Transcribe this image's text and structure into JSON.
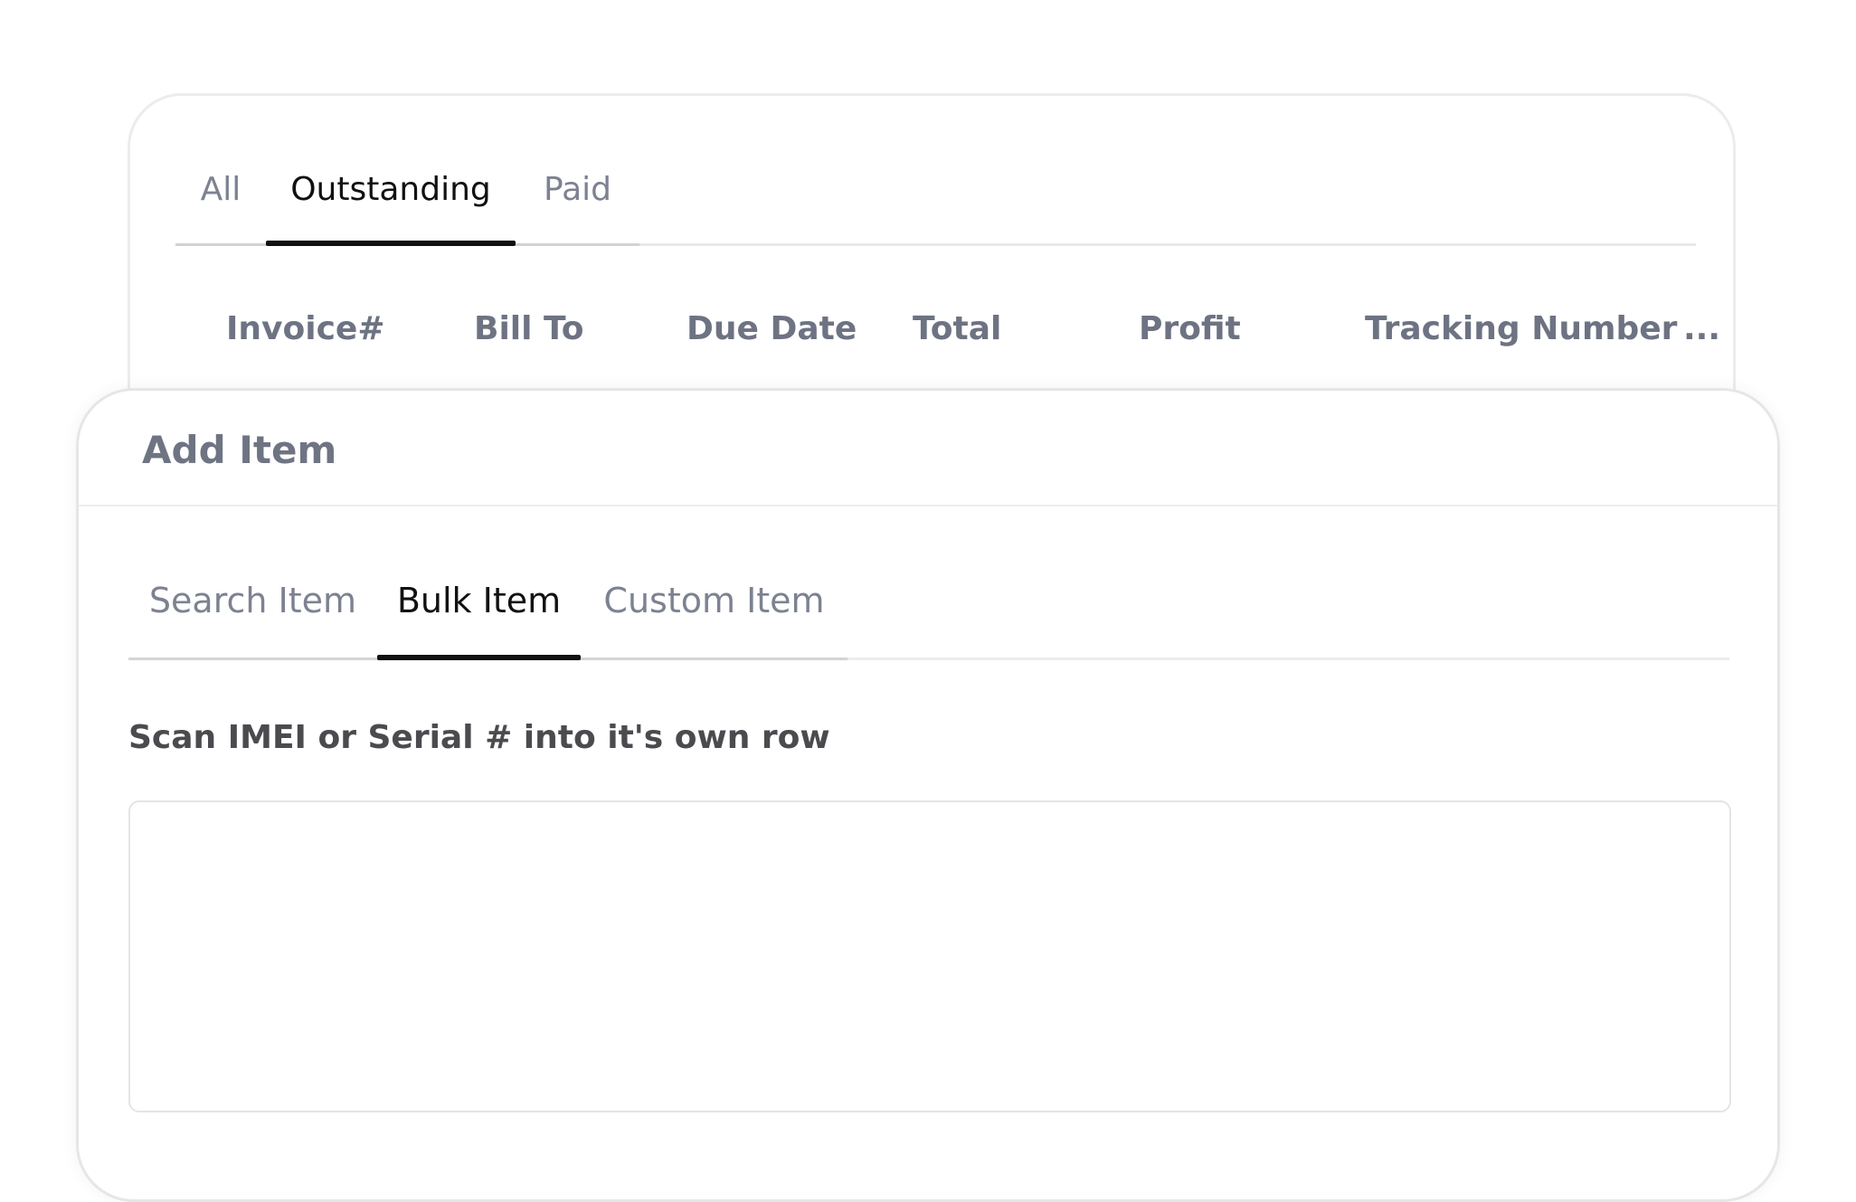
{
  "invoices": {
    "tabs": [
      {
        "label": "All",
        "active": false
      },
      {
        "label": "Outstanding",
        "active": true
      },
      {
        "label": "Paid",
        "active": false
      }
    ],
    "columns": [
      "Invoice#",
      "Bill To",
      "Due Date",
      "Total",
      "Profit",
      "Tracking Number"
    ],
    "more_columns_label": "..."
  },
  "add_item": {
    "title": "Add Item",
    "tabs": [
      {
        "label": "Search Item",
        "active": false
      },
      {
        "label": "Bulk Item",
        "active": true
      },
      {
        "label": "Custom Item",
        "active": false
      }
    ],
    "scan_label": "Scan IMEI or Serial # into it's own row",
    "scan_value": "",
    "scan_placeholder": ""
  },
  "colors": {
    "active_tab": "#111111",
    "inactive_tab": "#7c8291",
    "heading": "#6f7483",
    "border": "#e6e6ea"
  }
}
